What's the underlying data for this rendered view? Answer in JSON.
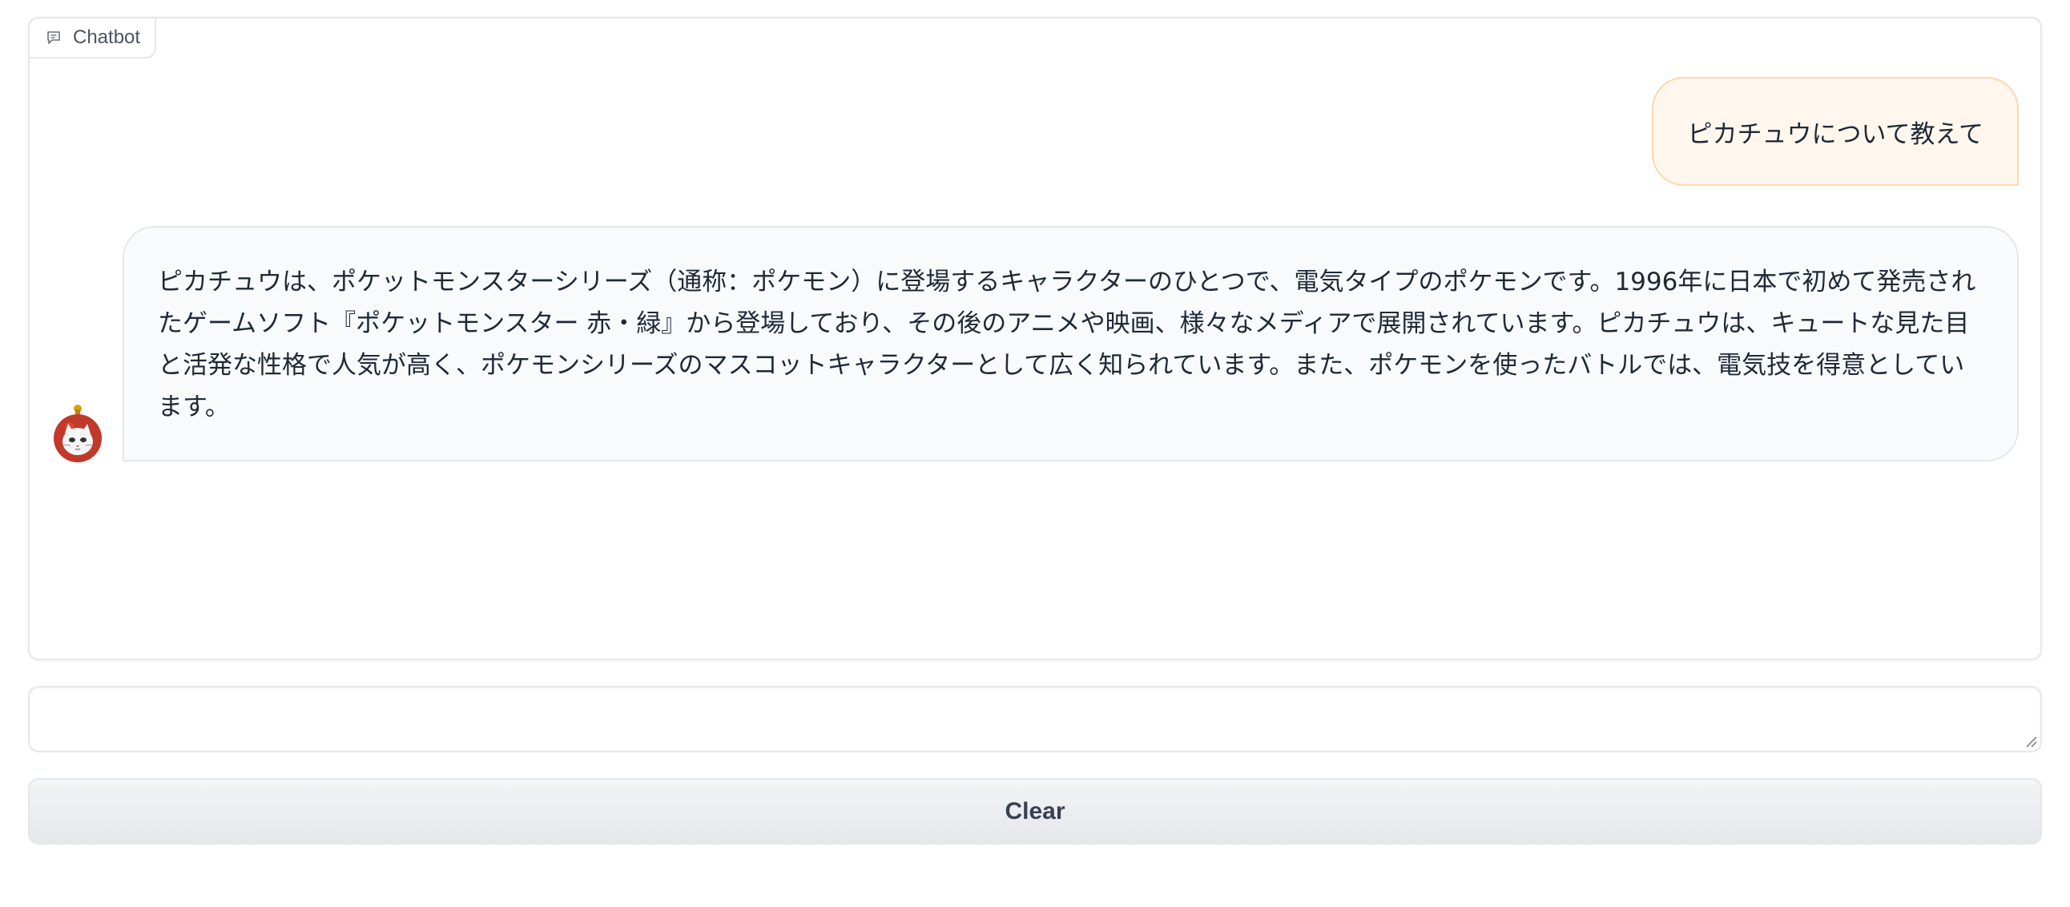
{
  "panel": {
    "label": "Chatbot",
    "label_icon": "chat-icon"
  },
  "messages": {
    "user": "ピカチュウについて教えて",
    "bot": "ピカチュウは、ポケットモンスターシリーズ（通称：ポケモン）に登場するキャラクターのひとつで、電気タイプのポケモンです。1996年に日本で初めて発売されたゲームソフト『ポケットモンスター 赤・緑』から登場しており、その後のアニメや映画、様々なメディアで展開されています。ピカチュウは、キュートな見た目と活発な性格で人気が高く、ポケモンシリーズのマスコットキャラクターとして広く知られています。また、ポケモンを使ったバトルでは、電気技を得意としています。",
    "bot_avatar_icon": "daruma-cat-avatar"
  },
  "input": {
    "value": "",
    "placeholder": ""
  },
  "buttons": {
    "clear_label": "Clear"
  },
  "colors": {
    "user_bubble_bg": "#fff7ed",
    "user_bubble_border": "#fed7aa",
    "bot_bubble_bg": "#f8fafc",
    "border": "#e5e7eb"
  }
}
